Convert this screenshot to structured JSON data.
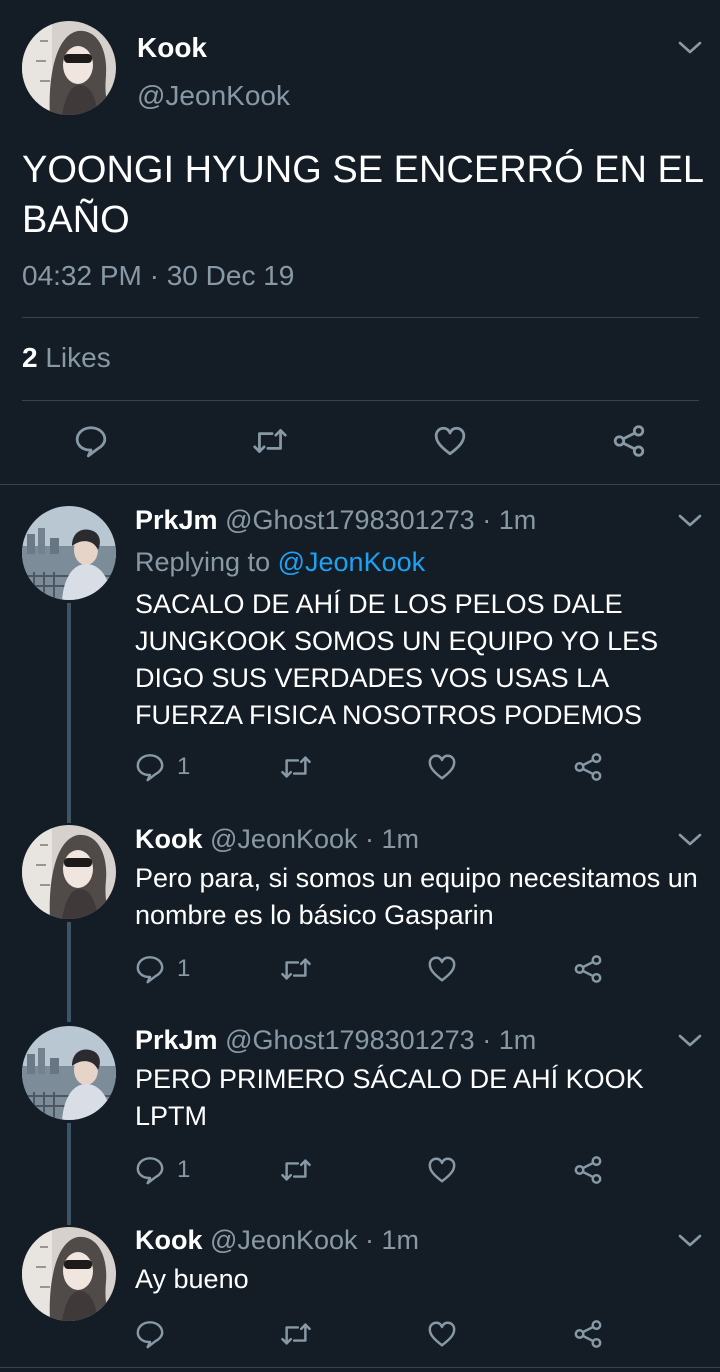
{
  "main_tweet": {
    "name": "Kook",
    "handle": "@JeonKook",
    "text": "YOONGI HYUNG SE ENCERRÓ EN EL BAÑO",
    "timestamp": "04:32 PM · 30 Dec 19",
    "likes_count": "2",
    "likes_label": "Likes"
  },
  "replies": [
    {
      "name": "PrkJm",
      "handle": "@Ghost1798301273",
      "time": "· 1m",
      "replying_prefix": "Replying to",
      "replying_handle": "@JeonKook",
      "text": "SACALO DE AHÍ DE LOS PELOS DALE JUNGKOOK SOMOS UN EQUIPO YO LES DIGO SUS VERDADES VOS USAS LA FUERZA FISICA NOSOTROS PODEMOS",
      "reply_count": "1"
    },
    {
      "name": "Kook",
      "handle": "@JeonKook",
      "time": "· 1m",
      "text": "Pero para, si somos un equipo necesitamos un nombre es lo básico Gasparin",
      "reply_count": "1"
    },
    {
      "name": "PrkJm",
      "handle": "@Ghost1798301273",
      "time": "· 1m",
      "text": "PERO PRIMERO SÁCALO DE AHÍ KOOK LPTM",
      "reply_count": "1"
    },
    {
      "name": "Kook",
      "handle": "@JeonKook",
      "time": "· 1m",
      "text": "Ay bueno",
      "reply_count": ""
    }
  ],
  "icons": {
    "reply": "reply-icon",
    "retweet": "retweet-icon",
    "like": "heart-icon",
    "share": "share-icon",
    "menu": "chevron-down-icon"
  },
  "colors": {
    "background": "#141d26",
    "secondary_text": "#8899a6",
    "link": "#1da1f2",
    "divider": "#38444d"
  }
}
